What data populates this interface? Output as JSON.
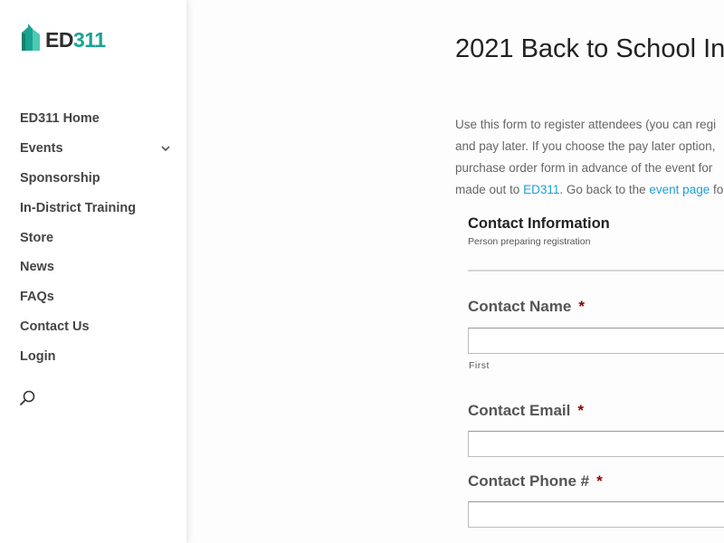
{
  "brand": {
    "logo_prefix": "ED",
    "logo_suffix": "311",
    "primary_color": "#1aa391",
    "dark_color": "#2d2d2d",
    "logo_icon": "book-building-icon"
  },
  "sidebar": {
    "items": [
      {
        "label": "ED311 Home",
        "has_submenu": false
      },
      {
        "label": "Events",
        "has_submenu": true
      },
      {
        "label": "Sponsorship",
        "has_submenu": false
      },
      {
        "label": "In-District Training",
        "has_submenu": false
      },
      {
        "label": "Store",
        "has_submenu": false
      },
      {
        "label": "News",
        "has_submenu": false
      },
      {
        "label": "FAQs",
        "has_submenu": false
      },
      {
        "label": "Contact Us",
        "has_submenu": false
      },
      {
        "label": "Login",
        "has_submenu": false
      }
    ],
    "search_icon": "search-icon"
  },
  "main": {
    "title": "2021 Back to School In",
    "intro": {
      "line1": "Use this form to register attendees (you can regi",
      "line2": "and pay later. If you choose the pay later option,",
      "line3": "purchase order form in advance of the event for",
      "line4_before": "made out to ",
      "line4_link1": "ED311",
      "line4_middle": ". Go back to the ",
      "line4_link2": "event page",
      "line4_after": " fo",
      "link_color": "#1e9fd7"
    },
    "section": {
      "title": "Contact Information",
      "description": "Person preparing registration"
    },
    "fields": [
      {
        "label": "Contact Name",
        "required_mark": "*",
        "value": "",
        "sublabel": "First"
      },
      {
        "label": "Contact Email",
        "required_mark": "*",
        "value": ""
      },
      {
        "label": "Contact Phone #",
        "required_mark": "*",
        "value": ""
      }
    ],
    "required_color": "#8b0000"
  }
}
